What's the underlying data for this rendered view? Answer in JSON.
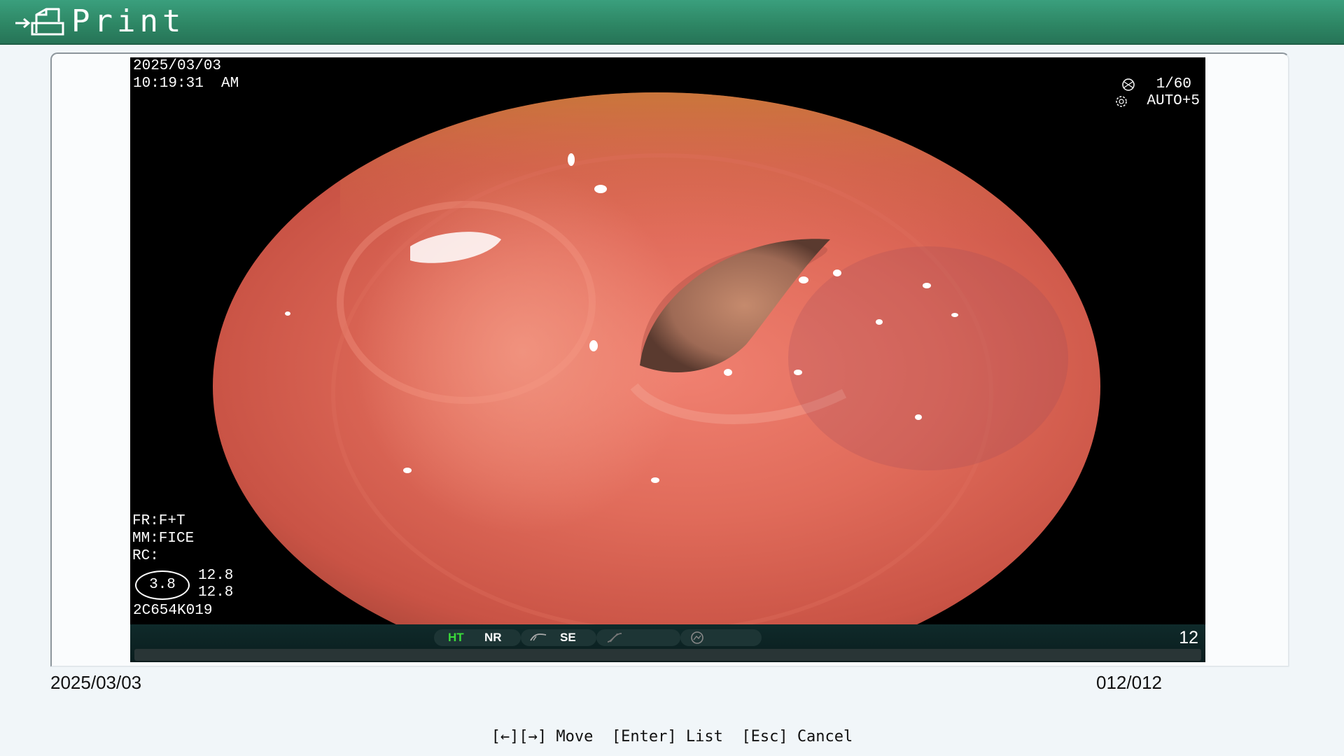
{
  "header": {
    "title": "Print",
    "icon": "print-arrow-icon",
    "bg_color": "#2e8765"
  },
  "image_overlay": {
    "date": "2025/03/03",
    "time": "10:19:31  AM",
    "shutter": "1/60",
    "exposure": "AUTO+5",
    "fr": "FR:F+T",
    "mm": "MM:FICE",
    "rc": "RC:",
    "oval_value": "3.8",
    "value_1": "12.8",
    "value_2": "12.8",
    "serial": "2C654K019",
    "status": {
      "ht": "HT",
      "nr": "NR",
      "se": "SE"
    },
    "frame_number": "12"
  },
  "footer": {
    "date": "2025/03/03",
    "page_counter": "012/012",
    "keys": {
      "move": "[←][→] Move",
      "list": "[Enter] List",
      "cancel": "[Esc] Cancel"
    }
  },
  "colors": {
    "background": "#f1f6f9",
    "header": "#2e8765",
    "ht_indicator": "#3adb3a"
  }
}
